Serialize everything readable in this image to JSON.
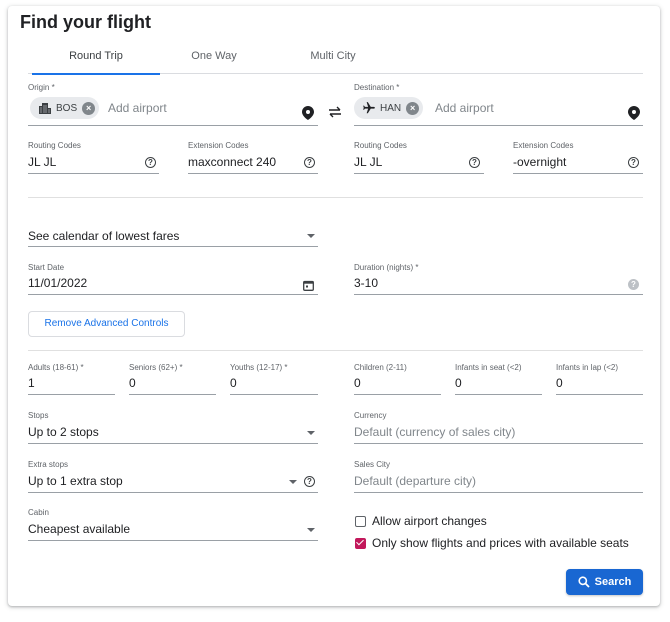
{
  "title": "Find your flight",
  "tabs": [
    {
      "label": "Round Trip",
      "active": true
    },
    {
      "label": "One Way",
      "active": false
    },
    {
      "label": "Multi City",
      "active": false
    }
  ],
  "origin": {
    "label": "Origin *",
    "chip": "BOS",
    "placeholder": "Add airport",
    "routing_label": "Routing Codes",
    "routing_value": "JL JL",
    "extension_label": "Extension Codes",
    "extension_value": "maxconnect 240"
  },
  "destination": {
    "label": "Destination *",
    "chip": "HAN",
    "placeholder": "Add airport",
    "routing_label": "Routing Codes",
    "routing_value": "JL JL",
    "extension_label": "Extension Codes",
    "extension_value": "-overnight"
  },
  "calendar_select": "See calendar of lowest fares",
  "start_date": {
    "label": "Start Date",
    "value": "11/01/2022"
  },
  "duration": {
    "label": "Duration (nights) *",
    "value": "3-10"
  },
  "advanced_button": "Remove Advanced Controls",
  "passengers": [
    {
      "label": "Adults (18-61) *",
      "value": "1"
    },
    {
      "label": "Seniors (62+) *",
      "value": "0"
    },
    {
      "label": "Youths (12-17) *",
      "value": "0"
    },
    {
      "label": "Children (2-11)",
      "value": "0"
    },
    {
      "label": "Infants in seat (<2)",
      "value": "0"
    },
    {
      "label": "Infants in lap (<2)",
      "value": "0"
    }
  ],
  "stops": {
    "label": "Stops",
    "value": "Up to 2 stops"
  },
  "currency": {
    "label": "Currency",
    "placeholder": "Default (currency of sales city)"
  },
  "extra_stops": {
    "label": "Extra stops",
    "value": "Up to 1 extra stop"
  },
  "sales_city": {
    "label": "Sales City",
    "placeholder": "Default (departure city)"
  },
  "cabin": {
    "label": "Cabin",
    "value": "Cheapest available"
  },
  "checkboxes": [
    {
      "label": "Allow airport changes",
      "checked": false
    },
    {
      "label": "Only show flights and prices with available seats",
      "checked": true
    }
  ],
  "search_button": "Search",
  "icons": {
    "origin_chip": "city-icon",
    "destination_chip": "airplane-icon",
    "swap": "swap-icon",
    "location": "location-pin-icon",
    "help": "help-circle-icon",
    "calendar": "calendar-icon",
    "search": "search-icon"
  },
  "colors": {
    "accent": "#1a73e8",
    "button": "#1967d2",
    "checkbox_on": "#c2185b"
  }
}
